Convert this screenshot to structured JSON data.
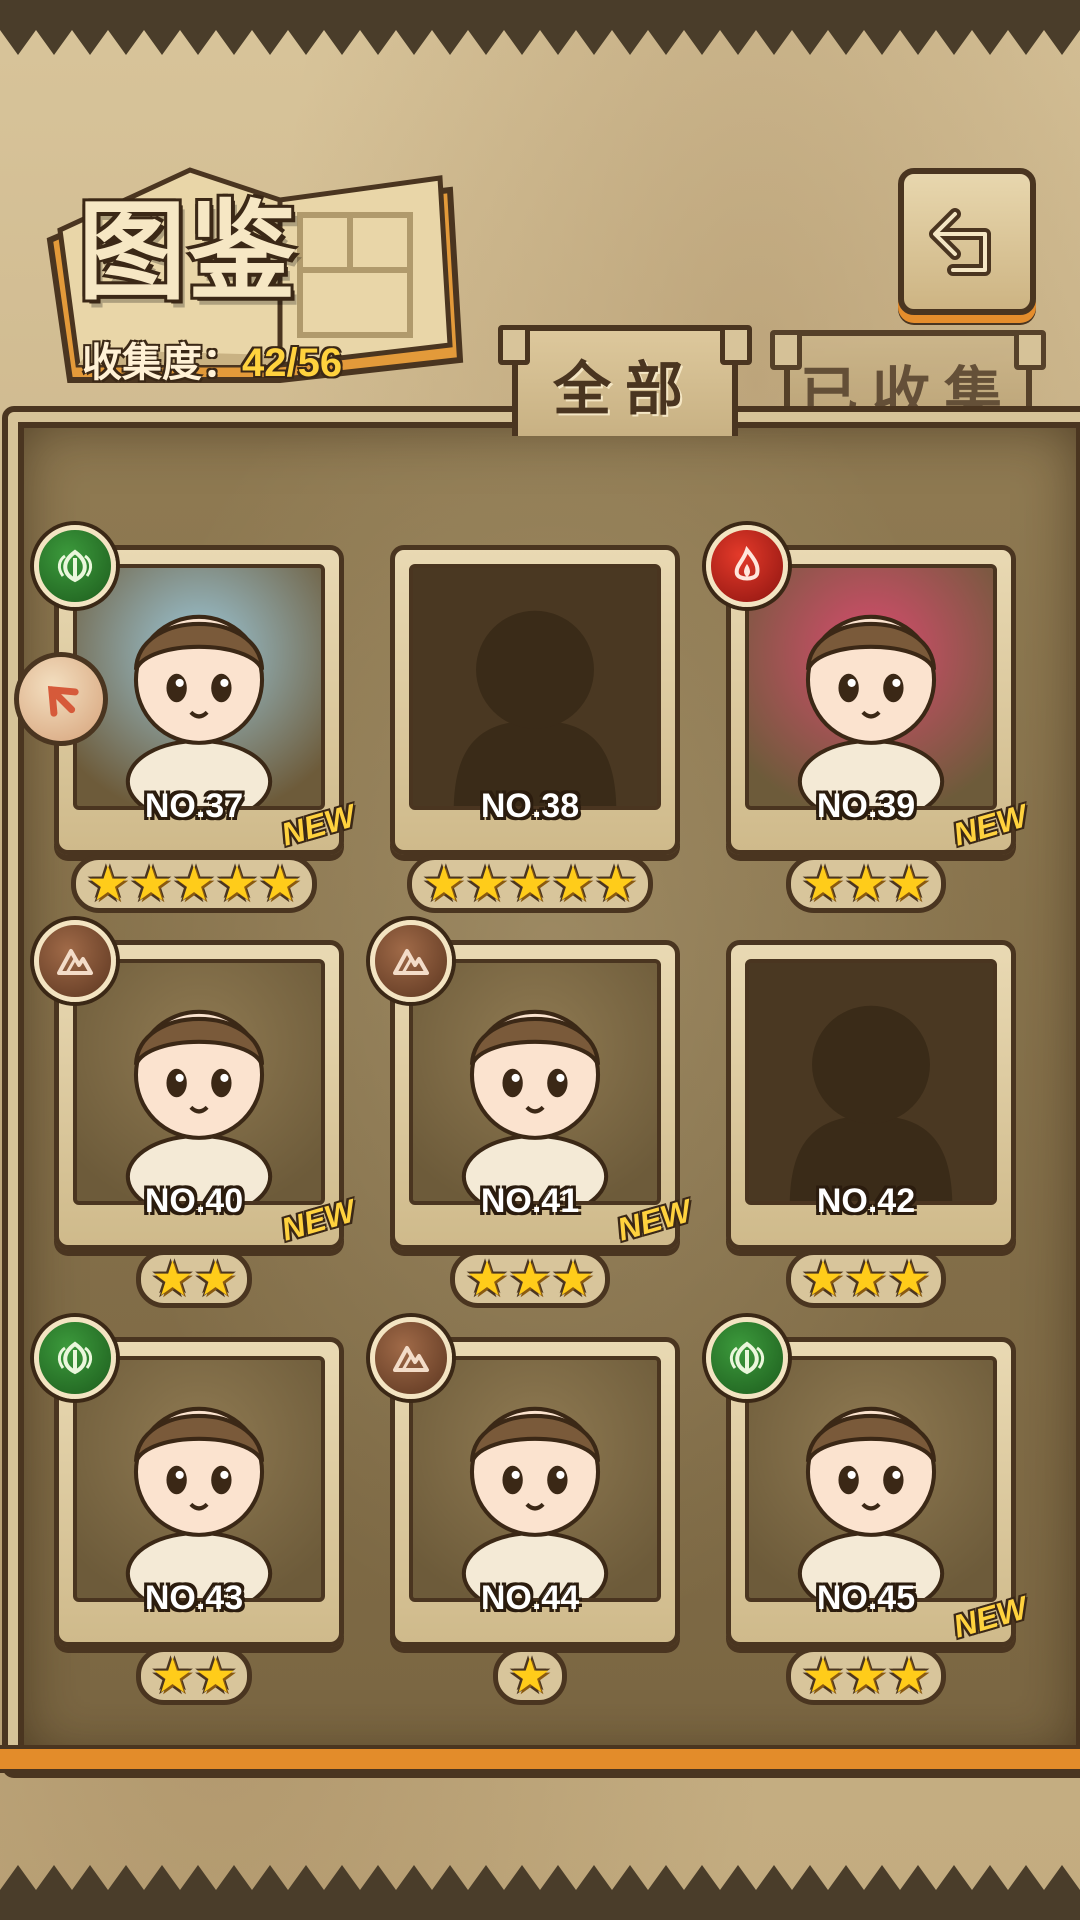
{
  "header": {
    "title": "图鉴",
    "collection_label": "收集度：",
    "collection_value": "42/56"
  },
  "tabs": [
    {
      "label": "全部",
      "active": true
    },
    {
      "label": "已收集",
      "active": false
    }
  ],
  "cards": [
    {
      "number": "NO.37",
      "stars": "★★★★★",
      "new_label": "NEW",
      "element": "wind-icon",
      "discovered": true,
      "art_color": "#9cc7d8"
    },
    {
      "number": "NO.38",
      "stars": "★★★★★",
      "new_label": "",
      "element": "",
      "discovered": false,
      "art_color": "#4a3822"
    },
    {
      "number": "NO.39",
      "stars": "★★★",
      "new_label": "NEW",
      "element": "fire-icon",
      "discovered": true,
      "art_color": "#d84b6e"
    },
    {
      "number": "NO.40",
      "stars": "★★",
      "new_label": "NEW",
      "element": "earth-icon",
      "discovered": true,
      "art_color": "#8f7a52"
    },
    {
      "number": "NO.41",
      "stars": "★★★",
      "new_label": "NEW",
      "element": "earth-icon",
      "discovered": true,
      "art_color": "#8f7a52"
    },
    {
      "number": "NO.42",
      "stars": "★★★",
      "new_label": "",
      "element": "",
      "discovered": false,
      "art_color": "#4a3822"
    },
    {
      "number": "NO.43",
      "stars": "★★",
      "new_label": "",
      "element": "wind-icon",
      "discovered": true,
      "art_color": "#8f7a52"
    },
    {
      "number": "NO.44",
      "stars": "★",
      "new_label": "",
      "element": "earth-icon",
      "discovered": true,
      "art_color": "#8f7a52"
    },
    {
      "number": "NO.45",
      "stars": "★★★",
      "new_label": "NEW",
      "element": "wind-icon",
      "discovered": true,
      "art_color": "#8f7a52"
    }
  ],
  "colors": {
    "accent": "#ffd23e",
    "frame_dark": "#4a3520",
    "orange_trim": "#e38c2a"
  }
}
